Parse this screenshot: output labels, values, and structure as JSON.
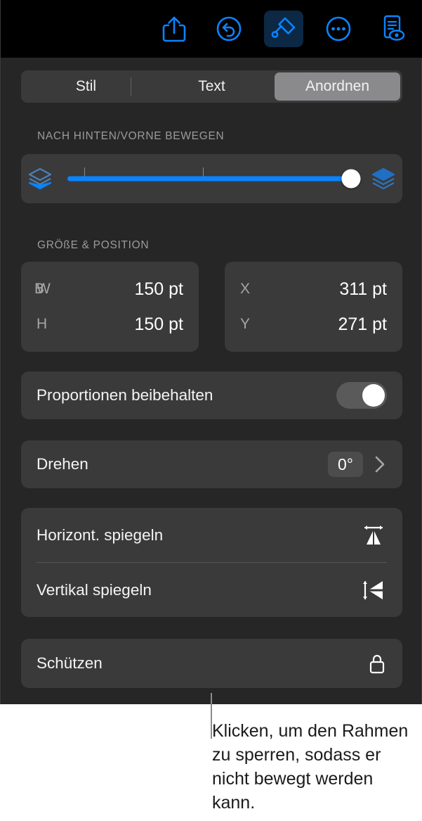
{
  "toolbar": {
    "buttons": [
      {
        "name": "share-icon",
        "label": "Teilen",
        "active": false
      },
      {
        "name": "undo-icon",
        "label": "Widerrufen",
        "active": false
      },
      {
        "name": "format-brush-icon",
        "label": "Format",
        "active": true
      },
      {
        "name": "more-options-icon",
        "label": "Mehr",
        "active": false
      },
      {
        "name": "document-view-icon",
        "label": "Dokument",
        "active": false
      }
    ],
    "accent_color": "#0a84ff",
    "active_background": "#0c2844",
    "background": "#000000"
  },
  "tabs": {
    "items": [
      {
        "label": "Stil",
        "selected": false
      },
      {
        "label": "Text",
        "selected": false
      },
      {
        "label": "Anordnen",
        "selected": true
      }
    ],
    "selected_background": "#8a8a8d"
  },
  "arrange_section": {
    "heading": "NACH HINTEN/VORNE BEWEGEN",
    "slider": {
      "value_percent": 97,
      "tick_positions_percent": [
        7,
        47
      ],
      "track_color": "#0a84ff",
      "knob_color": "#ffffff",
      "back_icon": "send-backward-layers-icon",
      "front_icon": "bring-forward-layers-icon"
    }
  },
  "size_position": {
    "heading": "GRÖßE & POSITION",
    "fields": [
      {
        "label": "W",
        "value": "150 pt",
        "glitch": true
      },
      {
        "label": "H",
        "value": "150 pt",
        "glitch": false
      },
      {
        "label": "X",
        "value": "311 pt",
        "glitch": false
      },
      {
        "label": "Y",
        "value": "271 pt",
        "glitch": false
      }
    ]
  },
  "proportions": {
    "label": "Proportionen beibehalten",
    "toggle_on": true
  },
  "rotate": {
    "label": "Drehen",
    "value": "0°"
  },
  "flip": {
    "horizontal_label": "Horizont. spiegeln",
    "vertical_label": "Vertikal spiegeln"
  },
  "protect": {
    "label": "Schützen",
    "icon": "lock-icon"
  },
  "callout": {
    "text": "Klicken, um den Rahmen zu sperren, sodass er nicht bewegt werden kann."
  }
}
